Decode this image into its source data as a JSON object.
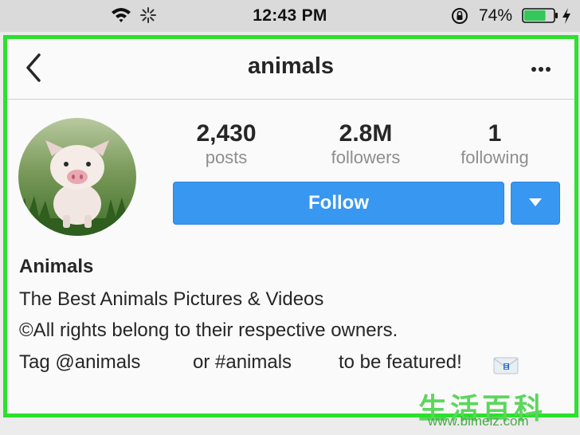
{
  "status_bar": {
    "time": "12:43 PM",
    "battery_percent": "74%",
    "battery_level": 0.74,
    "icons": [
      "wifi-icon",
      "activity-spinner-icon",
      "orientation-lock-icon",
      "battery-icon",
      "charging-bolt-icon"
    ]
  },
  "nav": {
    "title": "animals",
    "back_icon": "chevron-left-icon",
    "more_icon": "ellipsis-icon"
  },
  "profile": {
    "stats": [
      {
        "value": "2,430",
        "label": "posts"
      },
      {
        "value": "2.8M",
        "label": "followers"
      },
      {
        "value": "1",
        "label": "following"
      }
    ],
    "follow_label": "Follow",
    "dropdown_icon": "caret-down-icon",
    "bio": {
      "name": "Animals",
      "line1": "The Best Animals Pictures & Videos",
      "line2": "©All rights belong to their respective owners.",
      "line3_parts": [
        "Tag @animals",
        "or #animals",
        "to be featured!"
      ]
    }
  },
  "highlight_color": "#2ce02c",
  "accent_color": "#3897f0",
  "watermark": {
    "chars": "生活百科",
    "url": "www.bimeiz.com"
  }
}
